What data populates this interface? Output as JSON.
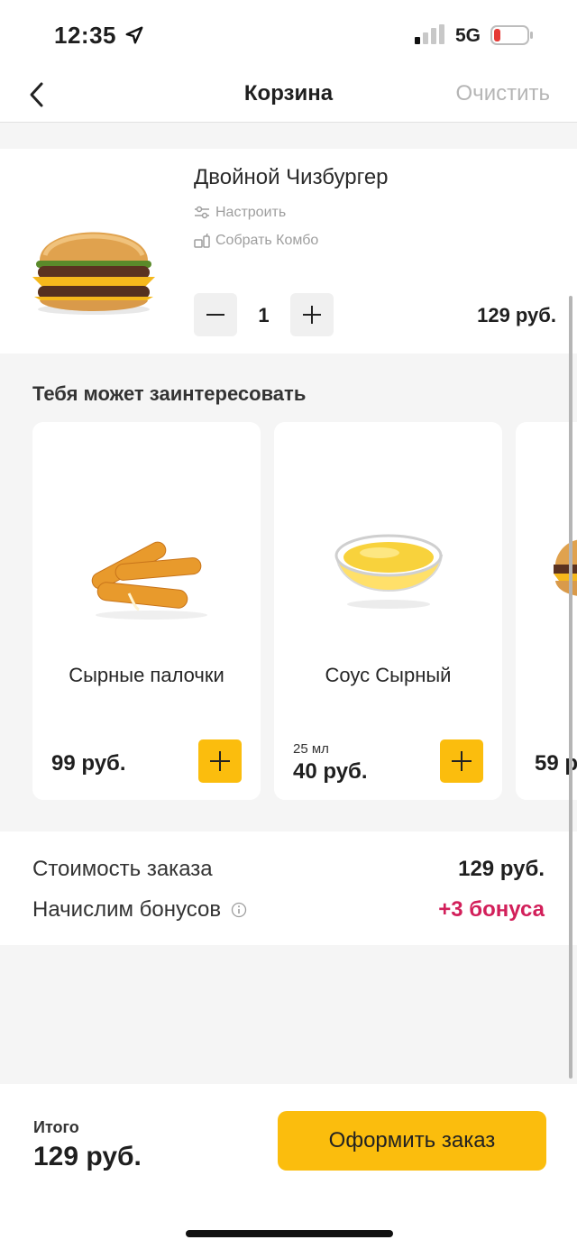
{
  "status": {
    "time": "12:35",
    "network": "5G"
  },
  "nav": {
    "title": "Корзина",
    "clear_label": "Очистить"
  },
  "cart_item": {
    "name": "Двойной Чизбургер",
    "customize_label": "Настроить",
    "combo_label": "Собрать Комбо",
    "quantity": "1",
    "price": "129 руб."
  },
  "recommendations": {
    "title": "Тебя может заинтересовать",
    "items": [
      {
        "name": "Сырные палочки",
        "price": "99 руб."
      },
      {
        "name": "Соус Сырный",
        "size": "25 мл",
        "price": "40 руб."
      },
      {
        "name": "",
        "price": "59 р"
      }
    ]
  },
  "summary": {
    "order_cost_label": "Стоимость заказа",
    "order_cost_value": "129 руб.",
    "bonus_label": "Начислим бонусов",
    "bonus_value": "+3 бонуса"
  },
  "footer": {
    "total_label": "Итого",
    "total_value": "129 руб.",
    "checkout_label": "Оформить заказ"
  },
  "colors": {
    "accent": "#fbbd0d",
    "bonus": "#d21f5a"
  }
}
